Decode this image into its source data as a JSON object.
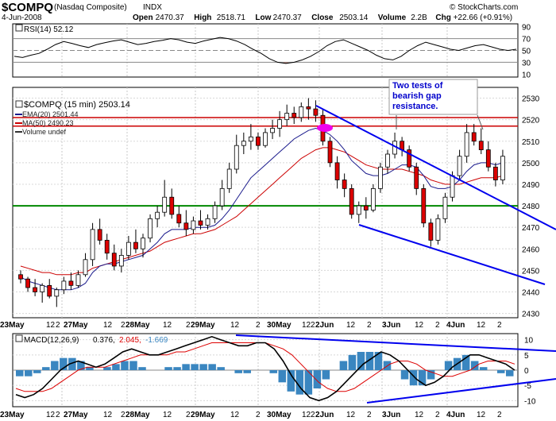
{
  "header": {
    "symbol": "$COMPQ",
    "name": "(Nasdaq Composite)",
    "exchange": "INDX",
    "date": "4-Jun-2008",
    "open_label": "Open",
    "open": "2470.37",
    "high_label": "High",
    "high": "2518.71",
    "low_label": "Low",
    "low": "2470.37",
    "close_label": "Close",
    "close": "2503.14",
    "volume_label": "Volume",
    "volume": "2.2B",
    "chg_label": "Chg",
    "chg": "+22.66 (+0.91%)",
    "copyright": "© StockCharts.com"
  },
  "rsi_panel": {
    "label": "RSI(14) 52.12",
    "ticks": [
      "90",
      "70",
      "50",
      "30",
      "10"
    ]
  },
  "price_panel": {
    "title": "$COMPQ (15 min) 2503.14",
    "legend": [
      {
        "text": "EMA(20) 2501.44",
        "color": "#1a1a8c"
      },
      {
        "text": "MA(50) 2490.23",
        "color": "#cc0000"
      },
      {
        "text": "Volume undef",
        "color": "#333333"
      }
    ],
    "annotation": [
      "Two tests of",
      "bearish gap",
      "resistance."
    ],
    "ticks": [
      "2530",
      "2520",
      "2510",
      "2500",
      "2490",
      "2480",
      "2470",
      "2460",
      "2450",
      "2440",
      "2430"
    ]
  },
  "macd_panel": {
    "label": "MACD(12,26,9)",
    "macd": "0.376,",
    "signal": "2.045,",
    "hist": "-1.669",
    "ticks": [
      "10",
      "5",
      "0",
      "-5",
      "-10"
    ]
  },
  "date_axis": [
    "23May",
    "12",
    "2",
    "27May",
    "12",
    "2",
    "28May",
    "12",
    "2",
    "29May",
    "12",
    "2",
    "30May",
    "12",
    "2",
    "2Jun",
    "12",
    "2",
    "3Jun",
    "12",
    "2",
    "4Jun",
    "12",
    "2"
  ],
  "colors": {
    "up": "#00a000",
    "down": "#dd0000",
    "ema": "#1a1a8c",
    "ma": "#cc0000",
    "resist": "#cc0000",
    "support": "#008800",
    "trend": "#0000ee",
    "hist": "#3a86c0",
    "macd": "#000000",
    "signal": "#dd0000",
    "annotation": "#0000cc",
    "marker": "#ee00ee"
  },
  "chart_data": {
    "type": "candlestick",
    "title": "$COMPQ (15 min) 2503.14",
    "ylim": [
      2428,
      2535
    ],
    "resistance_line": 2517,
    "resistance_line_2": 2521,
    "support_line": 2480,
    "candles": [
      [
        2448,
        2450,
        2444,
        2446
      ],
      [
        2446,
        2447,
        2440,
        2442
      ],
      [
        2442,
        2446,
        2438,
        2440
      ],
      [
        2440,
        2444,
        2435,
        2443
      ],
      [
        2443,
        2446,
        2437,
        2438
      ],
      [
        2438,
        2442,
        2433,
        2441
      ],
      [
        2441,
        2447,
        2439,
        2445
      ],
      [
        2445,
        2449,
        2441,
        2443
      ],
      [
        2443,
        2450,
        2442,
        2448
      ],
      [
        2448,
        2458,
        2447,
        2455
      ],
      [
        2455,
        2472,
        2452,
        2469
      ],
      [
        2469,
        2474,
        2462,
        2464
      ],
      [
        2464,
        2467,
        2455,
        2458
      ],
      [
        2458,
        2462,
        2450,
        2452
      ],
      [
        2452,
        2460,
        2449,
        2457
      ],
      [
        2457,
        2466,
        2455,
        2463
      ],
      [
        2463,
        2469,
        2458,
        2460
      ],
      [
        2460,
        2467,
        2456,
        2465
      ],
      [
        2465,
        2476,
        2463,
        2474
      ],
      [
        2474,
        2480,
        2470,
        2477
      ],
      [
        2477,
        2492,
        2475,
        2484
      ],
      [
        2484,
        2488,
        2474,
        2476
      ],
      [
        2476,
        2480,
        2470,
        2472
      ],
      [
        2472,
        2478,
        2466,
        2469
      ],
      [
        2469,
        2475,
        2467,
        2473
      ],
      [
        2473,
        2478,
        2469,
        2471
      ],
      [
        2471,
        2476,
        2469,
        2474
      ],
      [
        2474,
        2482,
        2472,
        2480
      ],
      [
        2480,
        2492,
        2478,
        2488
      ],
      [
        2488,
        2500,
        2486,
        2497
      ],
      [
        2497,
        2513,
        2495,
        2508
      ],
      [
        2508,
        2514,
        2504,
        2510
      ],
      [
        2510,
        2518,
        2506,
        2512
      ],
      [
        2512,
        2514,
        2506,
        2508
      ],
      [
        2508,
        2516,
        2507,
        2514
      ],
      [
        2514,
        2520,
        2511,
        2516
      ],
      [
        2516,
        2524,
        2512,
        2520
      ],
      [
        2520,
        2527,
        2517,
        2523
      ],
      [
        2523,
        2526,
        2518,
        2521
      ],
      [
        2521,
        2528,
        2519,
        2526
      ],
      [
        2526,
        2530,
        2520,
        2525
      ],
      [
        2525,
        2529,
        2519,
        2522
      ],
      [
        2522,
        2525,
        2508,
        2510
      ],
      [
        2510,
        2512,
        2498,
        2500
      ],
      [
        2500,
        2503,
        2488,
        2492
      ],
      [
        2492,
        2495,
        2484,
        2488
      ],
      [
        2488,
        2490,
        2474,
        2476
      ],
      [
        2476,
        2482,
        2472,
        2480
      ],
      [
        2480,
        2484,
        2474,
        2478
      ],
      [
        2478,
        2490,
        2477,
        2488
      ],
      [
        2488,
        2500,
        2486,
        2498
      ],
      [
        2498,
        2506,
        2495,
        2504
      ],
      [
        2504,
        2514,
        2502,
        2510
      ],
      [
        2510,
        2512,
        2503,
        2506
      ],
      [
        2506,
        2508,
        2496,
        2498
      ],
      [
        2498,
        2500,
        2485,
        2488
      ],
      [
        2488,
        2490,
        2470,
        2472
      ],
      [
        2472,
        2474,
        2461,
        2464
      ],
      [
        2464,
        2476,
        2462,
        2474
      ],
      [
        2474,
        2486,
        2472,
        2484
      ],
      [
        2484,
        2496,
        2482,
        2494
      ],
      [
        2494,
        2506,
        2492,
        2503
      ],
      [
        2503,
        2518,
        2500,
        2514
      ],
      [
        2514,
        2518,
        2508,
        2510
      ],
      [
        2510,
        2516,
        2504,
        2506
      ],
      [
        2506,
        2510,
        2496,
        2498
      ],
      [
        2498,
        2500,
        2489,
        2492
      ],
      [
        2492,
        2506,
        2490,
        2503
      ]
    ],
    "ema": [
      2447,
      2445,
      2444,
      2443,
      2442,
      2441,
      2441,
      2441,
      2442,
      2444,
      2449,
      2452,
      2453,
      2453,
      2454,
      2455,
      2456,
      2457,
      2460,
      2463,
      2467,
      2469,
      2469,
      2469,
      2470,
      2470,
      2470,
      2471,
      2474,
      2478,
      2483,
      2488,
      2493,
      2496,
      2499,
      2502,
      2505,
      2508,
      2511,
      2513,
      2515,
      2516,
      2515,
      2513,
      2510,
      2506,
      2501,
      2498,
      2495,
      2494,
      2494,
      2495,
      2497,
      2499,
      2499,
      2498,
      2494,
      2489,
      2488,
      2488,
      2489,
      2492,
      2496,
      2499,
      2500,
      2500,
      2499,
      2500
    ],
    "ma": [
      2452,
      2451,
      2450,
      2449,
      2449,
      2448,
      2448,
      2448,
      2449,
      2449,
      2451,
      2452,
      2453,
      2454,
      2455,
      2456,
      2457,
      2458,
      2459,
      2461,
      2463,
      2464,
      2465,
      2466,
      2467,
      2467,
      2468,
      2469,
      2471,
      2473,
      2475,
      2478,
      2481,
      2484,
      2487,
      2490,
      2493,
      2496,
      2499,
      2502,
      2504,
      2506,
      2507,
      2507,
      2506,
      2505,
      2503,
      2501,
      2499,
      2498,
      2497,
      2497,
      2497,
      2497,
      2496,
      2495,
      2494,
      2492,
      2491,
      2490,
      2490,
      2490,
      2491,
      2492,
      2493,
      2493,
      2493,
      2494
    ],
    "rsi_values": [
      40,
      38,
      42,
      45,
      52,
      60,
      65,
      62,
      58,
      55,
      60,
      63,
      66,
      68,
      64,
      60,
      62,
      65,
      67,
      70,
      68,
      64,
      62,
      66,
      69,
      72,
      70,
      66,
      60,
      52,
      45,
      36,
      30,
      28,
      30,
      34,
      40,
      48,
      58,
      65,
      68,
      62,
      56,
      50,
      42,
      36,
      34,
      40,
      50,
      58,
      64,
      60,
      56,
      52,
      50,
      54,
      58,
      60,
      56,
      52,
      50,
      52
    ],
    "macd_values": [
      -8,
      -9,
      -8,
      -6,
      -3,
      0,
      2,
      3,
      2,
      1,
      2,
      4,
      6,
      7,
      6,
      5,
      5,
      6,
      7,
      8,
      9,
      10,
      11,
      10,
      9,
      8,
      8,
      9,
      9,
      7,
      3,
      -2,
      -6,
      -9,
      -10,
      -9,
      -7,
      -4,
      -1,
      2,
      4,
      6,
      5,
      3,
      0,
      -3,
      -5,
      -4,
      -2,
      1,
      3,
      5,
      5,
      4,
      3,
      2,
      0
    ],
    "signal_values": [
      -6,
      -7,
      -7,
      -7,
      -6,
      -4,
      -2,
      0,
      1,
      1,
      1,
      2,
      3,
      4,
      5,
      5,
      5,
      5,
      6,
      6,
      7,
      8,
      9,
      9,
      9,
      9,
      9,
      9,
      9,
      8,
      7,
      5,
      2,
      -1,
      -4,
      -6,
      -7,
      -7,
      -6,
      -4,
      -2,
      0,
      2,
      3,
      3,
      2,
      0,
      -1,
      -2,
      -2,
      -1,
      0,
      2,
      3,
      3,
      3,
      2
    ],
    "hist_values": [
      -2,
      -2,
      -1,
      1,
      3,
      4,
      4,
      3,
      1,
      0,
      1,
      2,
      3,
      3,
      1,
      0,
      0,
      1,
      1,
      2,
      2,
      2,
      2,
      1,
      0,
      -1,
      -1,
      0,
      0,
      -1,
      -4,
      -7,
      -8,
      -8,
      -6,
      -3,
      0,
      3,
      5,
      6,
      6,
      6,
      3,
      0,
      -3,
      -5,
      -5,
      -3,
      0,
      3,
      4,
      5,
      3,
      1,
      0,
      -1,
      -2
    ]
  }
}
